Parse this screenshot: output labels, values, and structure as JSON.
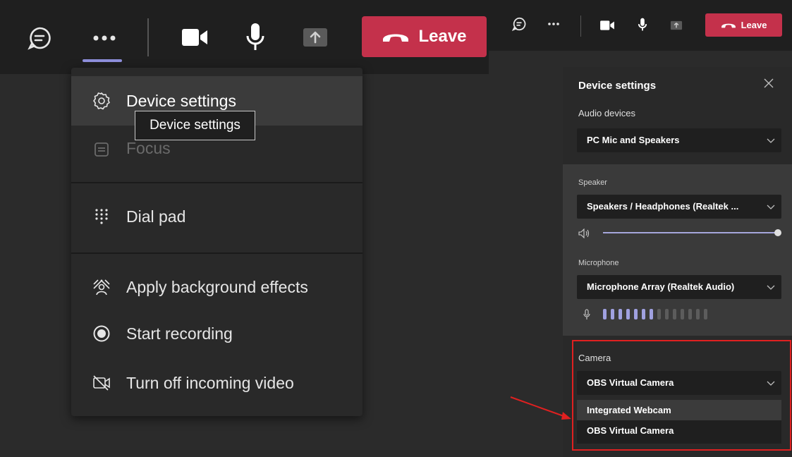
{
  "left": {
    "toolbar": {
      "leave_label": "Leave"
    },
    "menu": {
      "items": [
        {
          "label": "Device settings"
        },
        {
          "label": "Focus"
        },
        {
          "label": "Dial pad"
        },
        {
          "label": "Apply background effects"
        },
        {
          "label": "Start recording"
        },
        {
          "label": "Turn off incoming video"
        }
      ]
    },
    "tooltip": "Device settings"
  },
  "right": {
    "toolbar": {
      "leave_label": "Leave"
    },
    "panel": {
      "title": "Device settings",
      "audio_devices_label": "Audio devices",
      "audio_devices_value": "PC Mic and Speakers",
      "speaker_label": "Speaker",
      "speaker_value": "Speakers / Headphones (Realtek ...",
      "speaker_volume": 1.0,
      "microphone_label": "Microphone",
      "microphone_value": "Microphone Array (Realtek Audio)",
      "mic_level": {
        "active_bars": 7,
        "total_bars": 14
      },
      "camera_label": "Camera",
      "camera_value": "OBS Virtual Camera",
      "camera_options": [
        "Integrated Webcam",
        "OBS Virtual Camera"
      ]
    }
  },
  "colors": {
    "leave": "#c4314b",
    "accent": "#8e8fdb",
    "highlight": "#e02020"
  }
}
